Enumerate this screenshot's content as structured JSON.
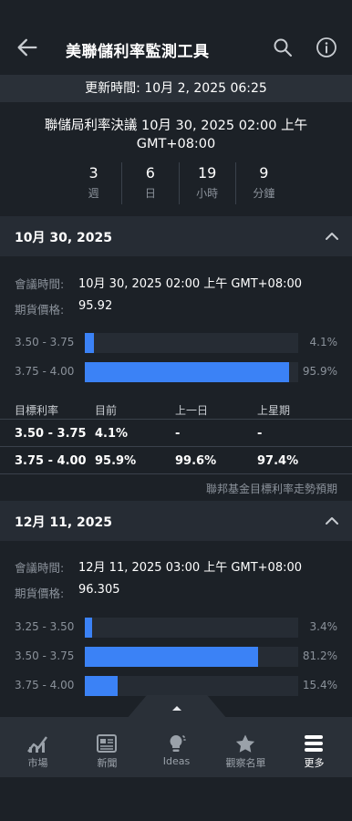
{
  "header": {
    "title": "美聯儲利率監測工具"
  },
  "updated": "更新時間: 10月 2, 2025 06:25",
  "fed_decision": {
    "title": "聯儲局利率決議 10月 30, 2025 02:00 上午 GMT+08:00",
    "countdown": [
      {
        "value": "3",
        "unit": "週"
      },
      {
        "value": "6",
        "unit": "日"
      },
      {
        "value": "19",
        "unit": "小時"
      },
      {
        "value": "9",
        "unit": "分鐘"
      }
    ]
  },
  "meetings": [
    {
      "date": "10月 30, 2025",
      "meeting_time_label": "會議時間:",
      "meeting_time": "10月 30, 2025 02:00 上午 GMT+08:00",
      "futures_label": "期貨價格:",
      "futures_price": "95.92",
      "bars": [
        {
          "range": "3.50 - 3.75",
          "pct": "4.1%",
          "value": 4.1
        },
        {
          "range": "3.75 - 4.00",
          "pct": "95.9%",
          "value": 95.9
        }
      ],
      "table": {
        "headers": [
          "目標利率",
          "目前",
          "上一日",
          "上星期"
        ],
        "rows": [
          [
            "3.50 - 3.75",
            "4.1%",
            "-",
            "-"
          ],
          [
            "3.75 - 4.00",
            "95.9%",
            "99.6%",
            "97.4%"
          ]
        ]
      },
      "footnote": "聯邦基金目標利率走勢預期"
    },
    {
      "date": "12月 11, 2025",
      "meeting_time_label": "會議時間:",
      "meeting_time": "12月 11, 2025 03:00 上午 GMT+08:00",
      "futures_label": "期貨價格:",
      "futures_price": "96.305",
      "bars": [
        {
          "range": "3.25 - 3.50",
          "pct": "3.4%",
          "value": 3.4
        },
        {
          "range": "3.50 - 3.75",
          "pct": "81.2%",
          "value": 81.2
        },
        {
          "range": "3.75 - 4.00",
          "pct": "15.4%",
          "value": 15.4
        }
      ]
    }
  ],
  "nav": [
    {
      "label": "市場",
      "icon": "chart-icon"
    },
    {
      "label": "新聞",
      "icon": "news-icon"
    },
    {
      "label": "Ideas",
      "icon": "lightbulb-icon"
    },
    {
      "label": "觀察名單",
      "icon": "star-icon"
    },
    {
      "label": "更多",
      "icon": "menu-icon"
    }
  ],
  "colors": {
    "accent": "#3b82f6",
    "background": "#1c2127",
    "panel": "#262c34"
  }
}
